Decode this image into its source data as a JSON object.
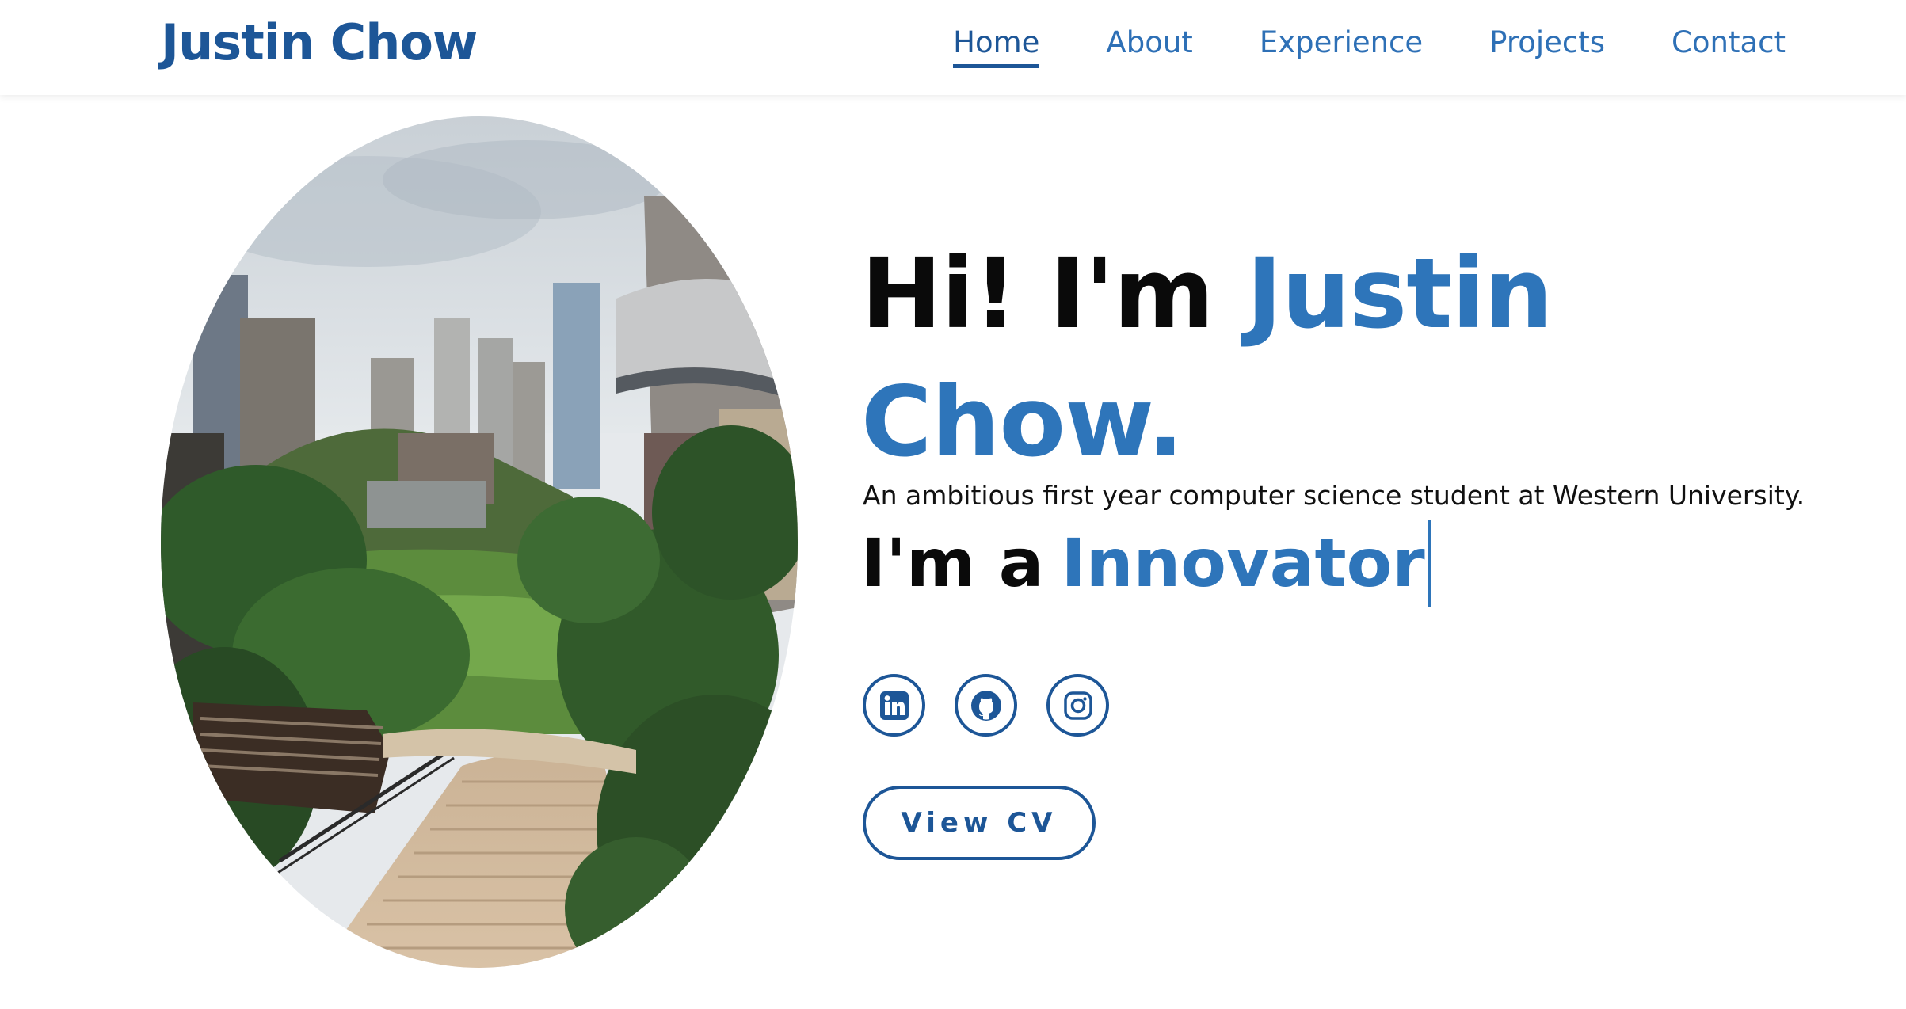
{
  "colors": {
    "brand": "#1d5697",
    "accent": "#2e75ba",
    "text": "#0a0a0a",
    "background": "#ffffff"
  },
  "navbar": {
    "brand": "Justin Chow",
    "links": [
      {
        "label": "Home",
        "active": true
      },
      {
        "label": "About",
        "active": false
      },
      {
        "label": "Experience",
        "active": false
      },
      {
        "label": "Projects",
        "active": false
      },
      {
        "label": "Contact",
        "active": false
      }
    ]
  },
  "hero": {
    "photo_icon": "profile-photo-cityscape",
    "greeting": "Hi! I'm",
    "name": "Justin Chow.",
    "subtitle": "An ambitious first year computer science student at Western University.",
    "typed_prefix": "I'm a",
    "typed_word": "Innovator",
    "socials": [
      {
        "icon": "linkedin-icon"
      },
      {
        "icon": "github-icon"
      },
      {
        "icon": "instagram-icon"
      }
    ],
    "cv_button": "View CV"
  }
}
